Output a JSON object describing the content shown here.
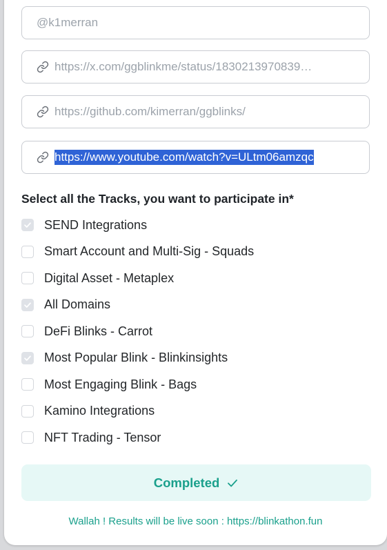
{
  "form": {
    "handle_field": {
      "value": "@k1merran"
    },
    "tweet_link_field": {
      "value": "https://x.com/ggblinkme/status/1830213970839…"
    },
    "github_link_field": {
      "value": "https://github.com/kimerran/ggblinks/"
    },
    "youtube_link_field": {
      "value": "https://www.youtube.com/watch?v=ULtm06amzqc"
    },
    "link_icon": "link-icon"
  },
  "tracks": {
    "heading": "Select all the Tracks, you want to participate in*",
    "items": [
      {
        "label": "SEND Integrations",
        "checked": true
      },
      {
        "label": "Smart Account and Multi-Sig - Squads",
        "checked": false
      },
      {
        "label": "Digital Asset - Metaplex",
        "checked": false
      },
      {
        "label": "All Domains",
        "checked": true
      },
      {
        "label": "DeFi Blinks - Carrot",
        "checked": false
      },
      {
        "label": "Most Popular Blink - Blinkinsights",
        "checked": true
      },
      {
        "label": "Most Engaging Blink - Bags",
        "checked": false
      },
      {
        "label": "Kamino Integrations",
        "checked": false
      },
      {
        "label": "NFT Trading - Tensor",
        "checked": false
      }
    ]
  },
  "status": {
    "button_label": "Completed",
    "note": "Wallah ! Results will be live soon : https://blinkathon.fun"
  },
  "colors": {
    "accent": "#1aa08c",
    "accent_bg": "#e6f8f6",
    "selection": "#2f63d6"
  }
}
